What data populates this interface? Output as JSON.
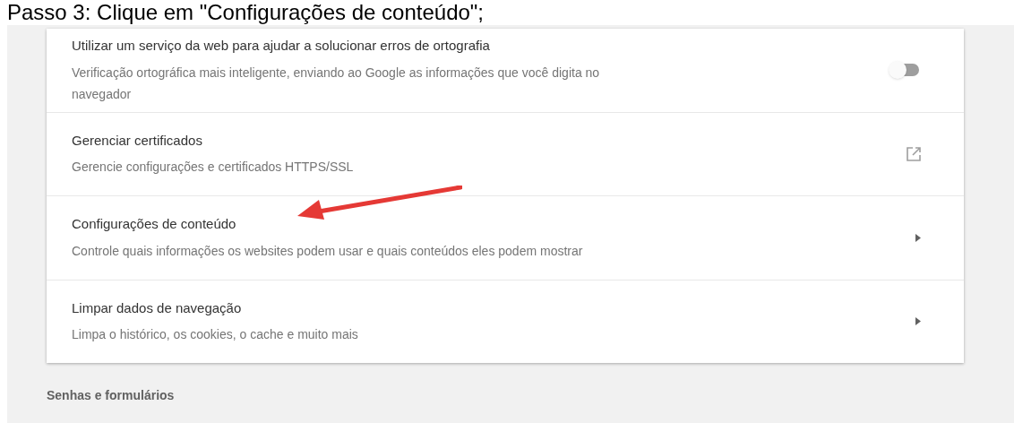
{
  "caption": "Passo 3: Clique em \"Configurações de conteúdo\";",
  "settings": [
    {
      "kind": "toggle",
      "title": "Utilizar um serviço da web para ajudar a solucionar erros de ortografia",
      "description": "Verificação ortográfica mais inteligente, enviando ao Google as informações que você digita no navegador",
      "on": false
    },
    {
      "kind": "external",
      "title": "Gerenciar certificados",
      "description": "Gerencie configurações e certificados HTTPS/SSL"
    },
    {
      "kind": "arrow",
      "title": "Configurações de conteúdo",
      "description": "Controle quais informações os websites podem usar e quais conteúdos eles podem mostrar"
    },
    {
      "kind": "arrow",
      "title": "Limpar dados de navegação",
      "description": "Limpa o histórico, os cookies, o cache e muito mais"
    }
  ],
  "section_heading": "Senhas e formulários"
}
